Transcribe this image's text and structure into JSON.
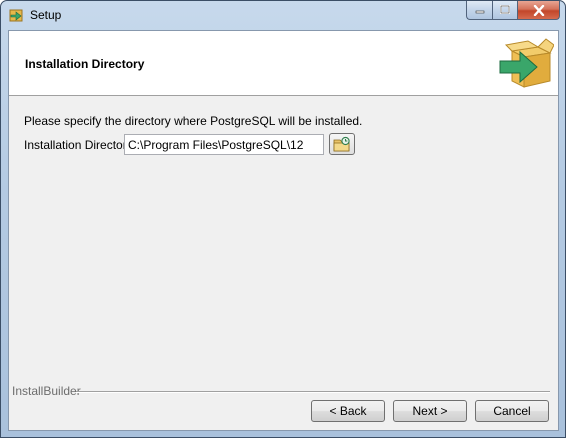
{
  "window": {
    "title": "Setup",
    "icon": "setup-installer-icon",
    "controls": [
      "minimize-icon",
      "maximize-icon",
      "close-icon"
    ]
  },
  "header": {
    "title": "Installation Directory",
    "logo": "box-arrow-icon"
  },
  "body": {
    "prompt": "Please specify the directory where PostgreSQL will be installed.",
    "directory_label": "Installation Directory",
    "directory_value": "C:\\Program Files\\PostgreSQL\\12",
    "browse_icon": "folder-browse-icon"
  },
  "footer": {
    "brand": "InstallBuilder",
    "back_label": "< Back",
    "next_label": "Next >",
    "cancel_label": "Cancel"
  },
  "colors": {
    "accent_green": "#3aa66a",
    "box_yellow": "#e6b84a",
    "close_red": "#c2462a"
  }
}
